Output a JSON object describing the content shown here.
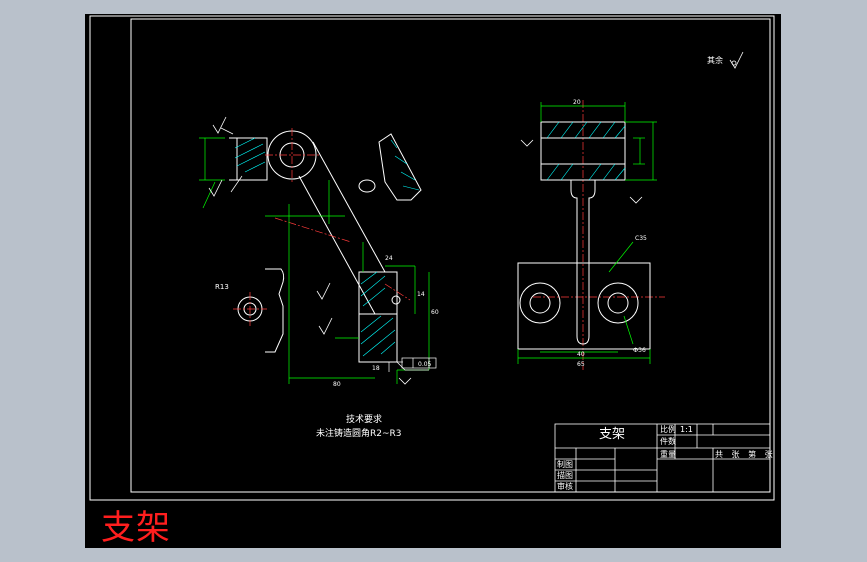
{
  "caption": "支架",
  "title_block": {
    "part_name": "支架",
    "scale_label": "比例",
    "scale_value": "1:1",
    "count_label": "件数",
    "weight_label": "重量",
    "sheet_info": "共 张 第 张",
    "drawn_label": "制图",
    "drawn2_label": "描图",
    "check_label": "审核"
  },
  "notes": {
    "heading": "技术要求",
    "line": "未注铸造圆角R2~R3"
  },
  "roughness_note": "其余",
  "dimension_labels": {
    "r13": "R13",
    "d20": "20",
    "c36": "C35",
    "phi36": "Ф36",
    "d40": "40",
    "d80": "80",
    "d65": "65",
    "d60": "60",
    "d18": "18",
    "d14": "14",
    "d24": "24",
    "tol": "0.05"
  },
  "colors": {
    "sheet": "#000000",
    "line": "#ffffff",
    "dim": "#00ff00",
    "cut": "#ff3b3b",
    "hatch": "#00ffff",
    "caption": "#ff1e1e",
    "leader": "#00ff00"
  }
}
